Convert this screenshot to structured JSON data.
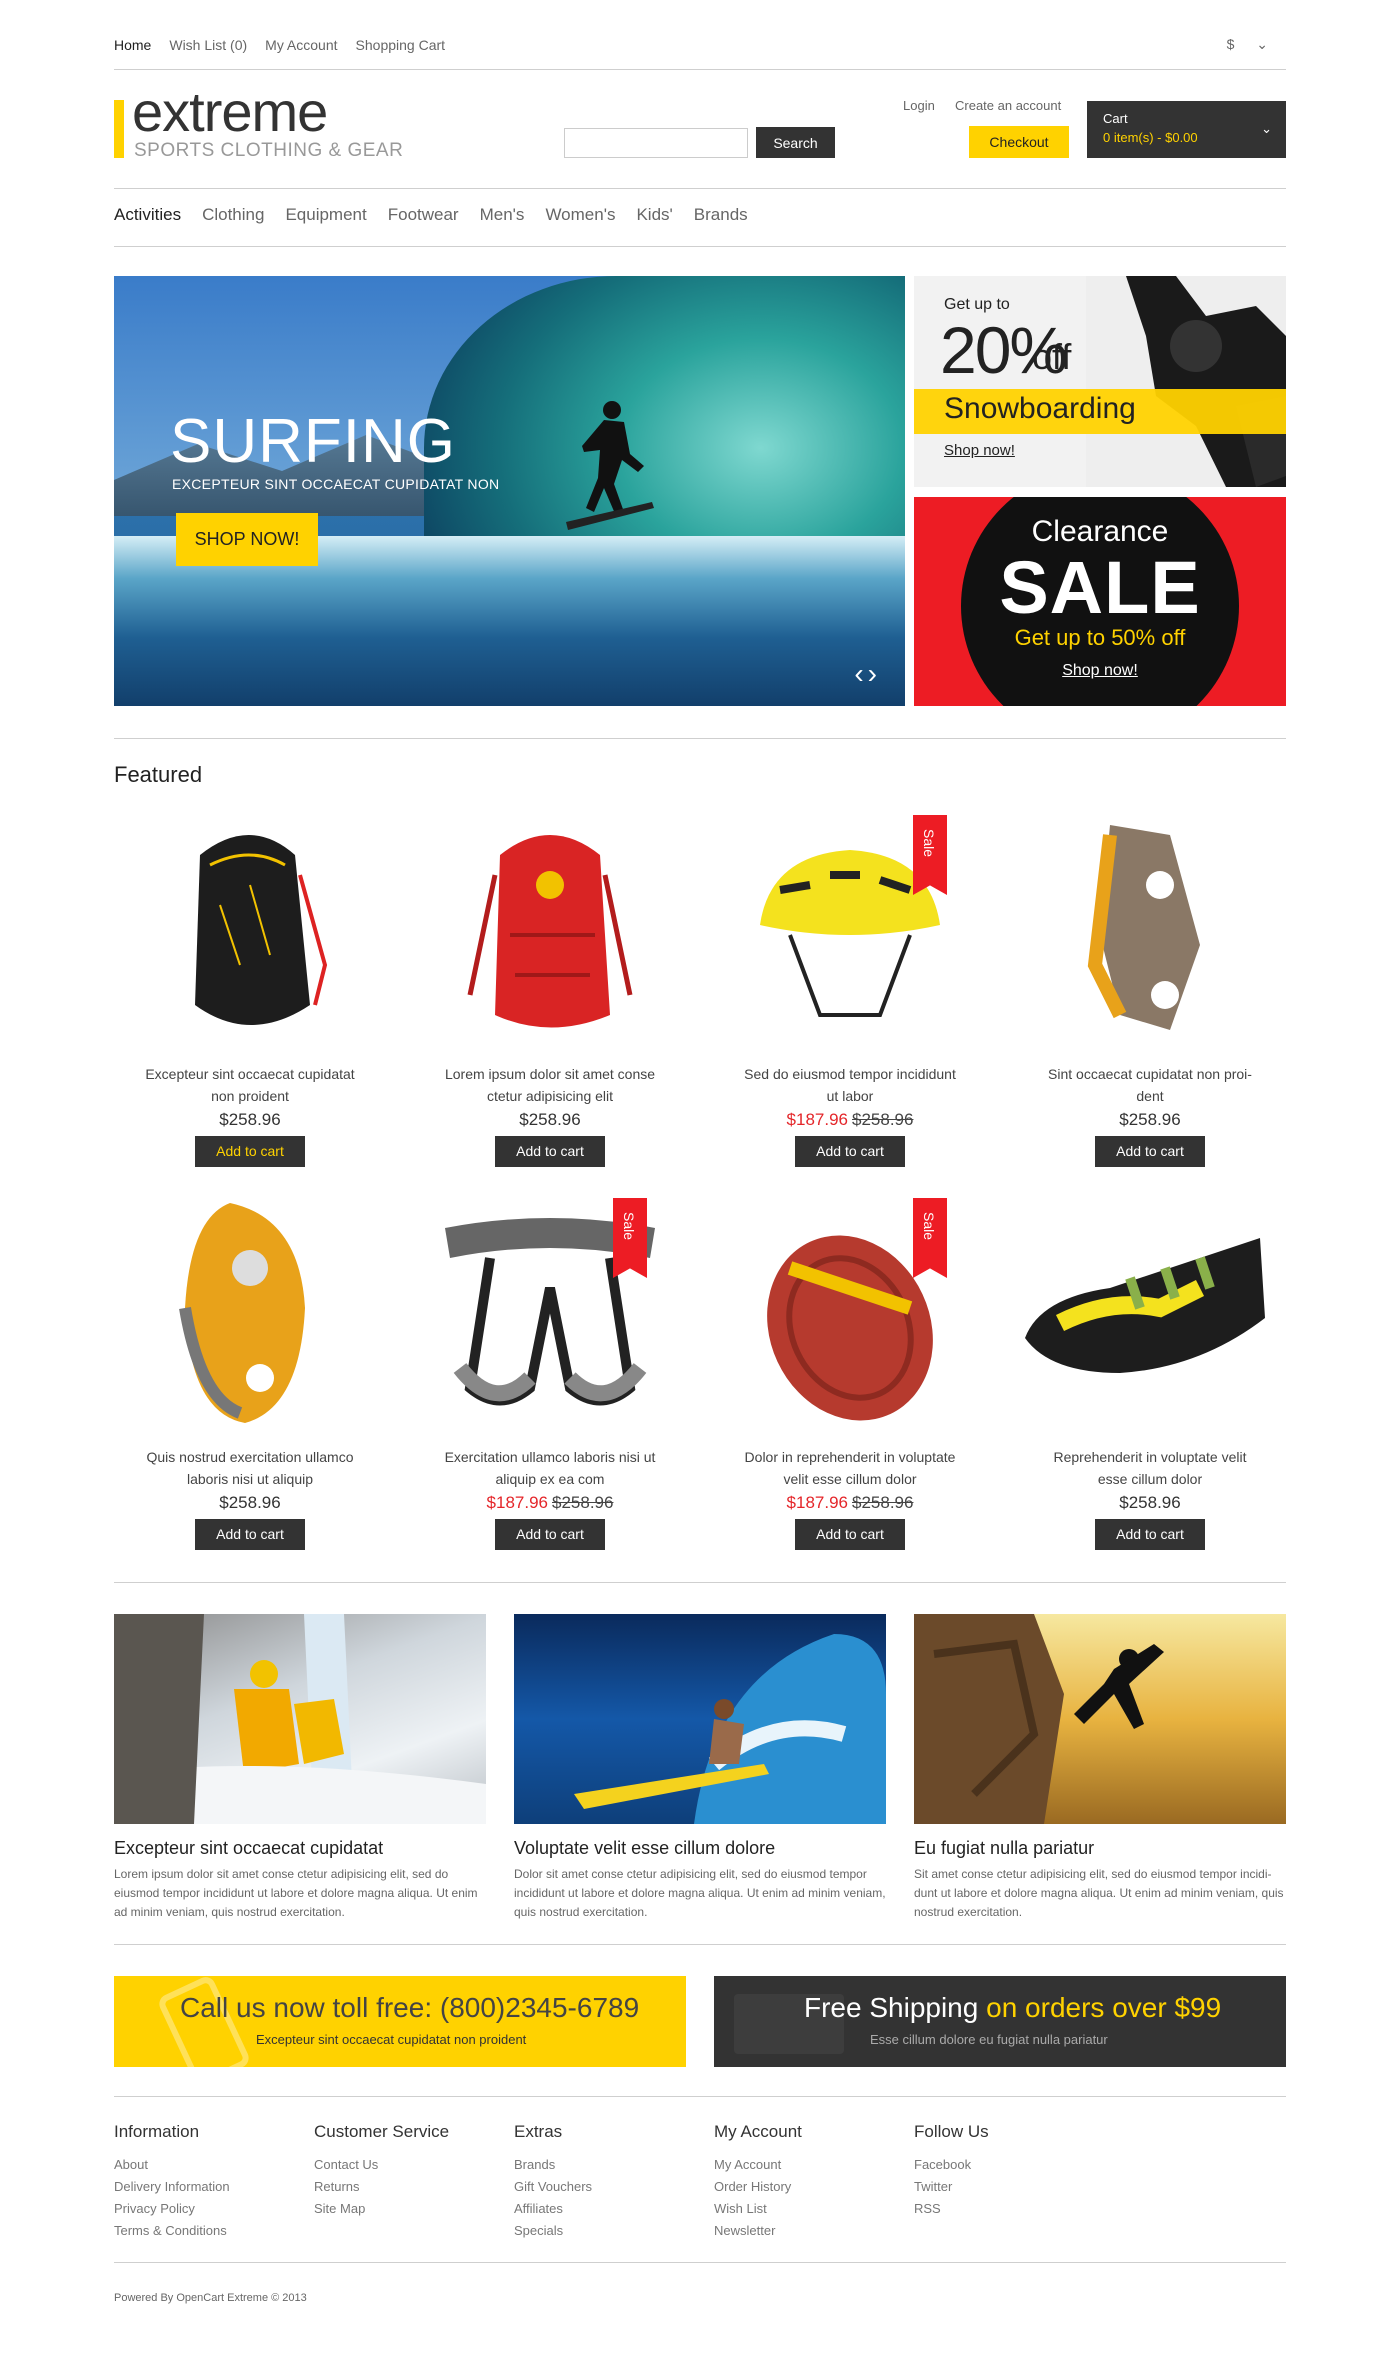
{
  "topnav": {
    "home": "Home",
    "wishlist": "Wish List (0)",
    "account": "My Account",
    "cart": "Shopping Cart",
    "currency": "$"
  },
  "logo": {
    "title": "extreme",
    "subtitle": "SPORTS CLOTHING & GEAR"
  },
  "search": {
    "button": "Search",
    "placeholder": ""
  },
  "header": {
    "login": "Login",
    "create_account": "Create an account",
    "checkout": "Checkout",
    "cart_label": "Cart",
    "cart_summary": "0 item(s) - $0.00"
  },
  "menu": [
    "Activities",
    "Clothing",
    "Equipment",
    "Footwear",
    "Men's",
    "Women's",
    "Kids'",
    "Brands"
  ],
  "hero": {
    "title": "SURFING",
    "subtitle": "EXCEPTEUR SINT OCCAECAT CUPIDATAT NON",
    "button": "SHOP NOW!"
  },
  "banner_snow": {
    "get_up": "Get up to",
    "pct": "20%",
    "off": "off",
    "name": "Snowboarding",
    "shop": "Shop now!"
  },
  "banner_sale": {
    "line1": "Clearance",
    "line2": "SALE",
    "line3": "Get up to 50% off",
    "shop": "Shop now!"
  },
  "featured": {
    "title": "Featured",
    "sale_label": "Sale",
    "products": [
      {
        "name": "Excepteur sint occaecat cupidatat non proident",
        "price": "$258.96",
        "old": "",
        "btn": "Add to cart"
      },
      {
        "name": "Lorem ipsum dolor sit amet conse ctetur adipisicing elit",
        "price": "$258.96",
        "old": "",
        "btn": "Add to cart"
      },
      {
        "name": "Sed do eiusmod tempor incididunt ut labor",
        "price": "$187.96",
        "old": "$258.96",
        "btn": "Add to cart"
      },
      {
        "name": "Sint occaecat cupidatat non proi-dent",
        "price": "$258.96",
        "old": "",
        "btn": "Add to cart"
      },
      {
        "name": "Quis nostrud exercitation ullamco laboris nisi ut aliquip",
        "price": "$258.96",
        "old": "",
        "btn": "Add to cart"
      },
      {
        "name": "Exercitation ullamco laboris nisi ut aliquip ex ea com",
        "price": "$187.96",
        "old": "$258.96",
        "btn": "Add to cart"
      },
      {
        "name": "Dolor in reprehenderit in voluptate velit esse cillum dolor",
        "price": "$187.96",
        "old": "$258.96",
        "btn": "Add to cart"
      },
      {
        "name": "Reprehenderit in voluptate velit esse cillum dolor",
        "price": "$258.96",
        "old": "",
        "btn": "Add to cart"
      }
    ]
  },
  "articles": [
    {
      "title": "Excepteur sint occaecat cupidatat",
      "text": "Lorem ipsum dolor sit amet conse ctetur adipisicing elit, sed do eiusmod tempor incididunt ut labore et dolore magna aliqua. Ut enim ad minim veniam, quis nostrud exercitation."
    },
    {
      "title": "Voluptate velit esse cillum dolore",
      "text": "Dolor sit amet conse ctetur adipisicing elit, sed do eiusmod tempor incididunt ut labore et dolore magna aliqua. Ut enim ad minim veniam, quis nostrud exercitation."
    },
    {
      "title": "Eu fugiat nulla pariatur",
      "text": "Sit amet conse ctetur adipisicing elit, sed do eiusmod tempor incidi-dunt ut labore et dolore magna aliqua. Ut enim ad minim veniam, quis nostrud exercitation."
    }
  ],
  "promo_call": {
    "title": "Call us now toll free: (800)2345-6789",
    "sub": "Excepteur sint occaecat cupidatat non proident"
  },
  "promo_ship": {
    "title_a": "Free Shipping",
    "title_b": " on orders over $99",
    "sub": "Esse cillum dolore eu fugiat nulla pariatur"
  },
  "footer": {
    "cols": [
      {
        "head": "Information",
        "links": [
          "About",
          "Delivery Information",
          "Privacy Policy",
          "Terms & Conditions"
        ]
      },
      {
        "head": "Customer Service",
        "links": [
          "Contact Us",
          "Returns",
          "Site Map"
        ]
      },
      {
        "head": "Extras",
        "links": [
          "Brands",
          "Gift Vouchers",
          "Affiliates",
          "Specials"
        ]
      },
      {
        "head": "My Account",
        "links": [
          "My Account",
          "Order History",
          "Wish List",
          "Newsletter"
        ]
      },
      {
        "head": "Follow Us",
        "links": [
          "Facebook",
          "Twitter",
          "RSS"
        ]
      }
    ],
    "powered": "Powered By OpenCart Extreme © 2013"
  },
  "colors": {
    "accent": "#ffd200",
    "dark": "#333333",
    "sale": "#ed1c24"
  }
}
